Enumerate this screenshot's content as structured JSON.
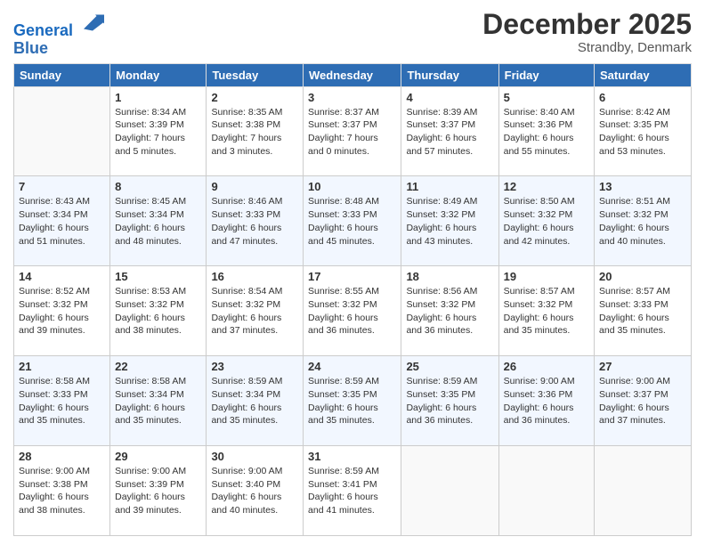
{
  "header": {
    "logo_line1": "General",
    "logo_line2": "Blue",
    "month": "December 2025",
    "location": "Strandby, Denmark"
  },
  "weekdays": [
    "Sunday",
    "Monday",
    "Tuesday",
    "Wednesday",
    "Thursday",
    "Friday",
    "Saturday"
  ],
  "weeks": [
    [
      {
        "day": "",
        "info": ""
      },
      {
        "day": "1",
        "info": "Sunrise: 8:34 AM\nSunset: 3:39 PM\nDaylight: 7 hours\nand 5 minutes."
      },
      {
        "day": "2",
        "info": "Sunrise: 8:35 AM\nSunset: 3:38 PM\nDaylight: 7 hours\nand 3 minutes."
      },
      {
        "day": "3",
        "info": "Sunrise: 8:37 AM\nSunset: 3:37 PM\nDaylight: 7 hours\nand 0 minutes."
      },
      {
        "day": "4",
        "info": "Sunrise: 8:39 AM\nSunset: 3:37 PM\nDaylight: 6 hours\nand 57 minutes."
      },
      {
        "day": "5",
        "info": "Sunrise: 8:40 AM\nSunset: 3:36 PM\nDaylight: 6 hours\nand 55 minutes."
      },
      {
        "day": "6",
        "info": "Sunrise: 8:42 AM\nSunset: 3:35 PM\nDaylight: 6 hours\nand 53 minutes."
      }
    ],
    [
      {
        "day": "7",
        "info": "Sunrise: 8:43 AM\nSunset: 3:34 PM\nDaylight: 6 hours\nand 51 minutes."
      },
      {
        "day": "8",
        "info": "Sunrise: 8:45 AM\nSunset: 3:34 PM\nDaylight: 6 hours\nand 48 minutes."
      },
      {
        "day": "9",
        "info": "Sunrise: 8:46 AM\nSunset: 3:33 PM\nDaylight: 6 hours\nand 47 minutes."
      },
      {
        "day": "10",
        "info": "Sunrise: 8:48 AM\nSunset: 3:33 PM\nDaylight: 6 hours\nand 45 minutes."
      },
      {
        "day": "11",
        "info": "Sunrise: 8:49 AM\nSunset: 3:32 PM\nDaylight: 6 hours\nand 43 minutes."
      },
      {
        "day": "12",
        "info": "Sunrise: 8:50 AM\nSunset: 3:32 PM\nDaylight: 6 hours\nand 42 minutes."
      },
      {
        "day": "13",
        "info": "Sunrise: 8:51 AM\nSunset: 3:32 PM\nDaylight: 6 hours\nand 40 minutes."
      }
    ],
    [
      {
        "day": "14",
        "info": "Sunrise: 8:52 AM\nSunset: 3:32 PM\nDaylight: 6 hours\nand 39 minutes."
      },
      {
        "day": "15",
        "info": "Sunrise: 8:53 AM\nSunset: 3:32 PM\nDaylight: 6 hours\nand 38 minutes."
      },
      {
        "day": "16",
        "info": "Sunrise: 8:54 AM\nSunset: 3:32 PM\nDaylight: 6 hours\nand 37 minutes."
      },
      {
        "day": "17",
        "info": "Sunrise: 8:55 AM\nSunset: 3:32 PM\nDaylight: 6 hours\nand 36 minutes."
      },
      {
        "day": "18",
        "info": "Sunrise: 8:56 AM\nSunset: 3:32 PM\nDaylight: 6 hours\nand 36 minutes."
      },
      {
        "day": "19",
        "info": "Sunrise: 8:57 AM\nSunset: 3:32 PM\nDaylight: 6 hours\nand 35 minutes."
      },
      {
        "day": "20",
        "info": "Sunrise: 8:57 AM\nSunset: 3:33 PM\nDaylight: 6 hours\nand 35 minutes."
      }
    ],
    [
      {
        "day": "21",
        "info": "Sunrise: 8:58 AM\nSunset: 3:33 PM\nDaylight: 6 hours\nand 35 minutes."
      },
      {
        "day": "22",
        "info": "Sunrise: 8:58 AM\nSunset: 3:34 PM\nDaylight: 6 hours\nand 35 minutes."
      },
      {
        "day": "23",
        "info": "Sunrise: 8:59 AM\nSunset: 3:34 PM\nDaylight: 6 hours\nand 35 minutes."
      },
      {
        "day": "24",
        "info": "Sunrise: 8:59 AM\nSunset: 3:35 PM\nDaylight: 6 hours\nand 35 minutes."
      },
      {
        "day": "25",
        "info": "Sunrise: 8:59 AM\nSunset: 3:35 PM\nDaylight: 6 hours\nand 36 minutes."
      },
      {
        "day": "26",
        "info": "Sunrise: 9:00 AM\nSunset: 3:36 PM\nDaylight: 6 hours\nand 36 minutes."
      },
      {
        "day": "27",
        "info": "Sunrise: 9:00 AM\nSunset: 3:37 PM\nDaylight: 6 hours\nand 37 minutes."
      }
    ],
    [
      {
        "day": "28",
        "info": "Sunrise: 9:00 AM\nSunset: 3:38 PM\nDaylight: 6 hours\nand 38 minutes."
      },
      {
        "day": "29",
        "info": "Sunrise: 9:00 AM\nSunset: 3:39 PM\nDaylight: 6 hours\nand 39 minutes."
      },
      {
        "day": "30",
        "info": "Sunrise: 9:00 AM\nSunset: 3:40 PM\nDaylight: 6 hours\nand 40 minutes."
      },
      {
        "day": "31",
        "info": "Sunrise: 8:59 AM\nSunset: 3:41 PM\nDaylight: 6 hours\nand 41 minutes."
      },
      {
        "day": "",
        "info": ""
      },
      {
        "day": "",
        "info": ""
      },
      {
        "day": "",
        "info": ""
      }
    ]
  ]
}
